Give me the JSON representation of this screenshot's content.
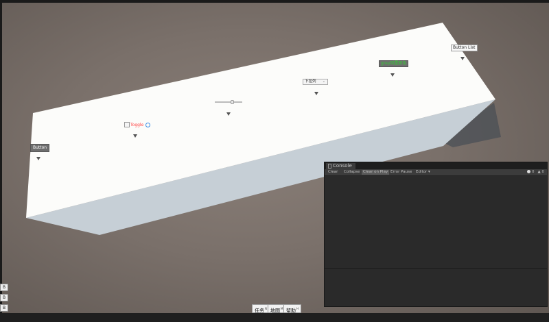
{
  "scene": {
    "buttons": {
      "button_label": "Button",
      "toggle_label": "Toggle",
      "dropdown_label": "下拉列",
      "gray_button_label": "grey列置颜色",
      "button_list_label": "Button List"
    },
    "slider_value": 0.65,
    "colors": {
      "background": "#7a706a",
      "box_top": "#fcfcfa",
      "box_side": "#c5cdd4",
      "gray_button_text": "#33cc33",
      "toggle_text": "#ff4040",
      "toggle_icon": "#3a8ee6"
    }
  },
  "console": {
    "title": "Console",
    "toolbar": {
      "clear": "Clear",
      "collapse": "Collapse",
      "clear_on_play": "Clear on Play",
      "error_pause": "Error Pause",
      "editor": "Editor"
    },
    "counts": {
      "info": "0",
      "warning": "0"
    }
  },
  "left_buttons": [
    "B",
    "B",
    "B"
  ],
  "bottom_buttons": [
    {
      "label": "任务",
      "hotkey": "N"
    },
    {
      "label": "地图",
      "hotkey": "M"
    },
    {
      "label": "帮助",
      "hotkey": "H"
    }
  ]
}
